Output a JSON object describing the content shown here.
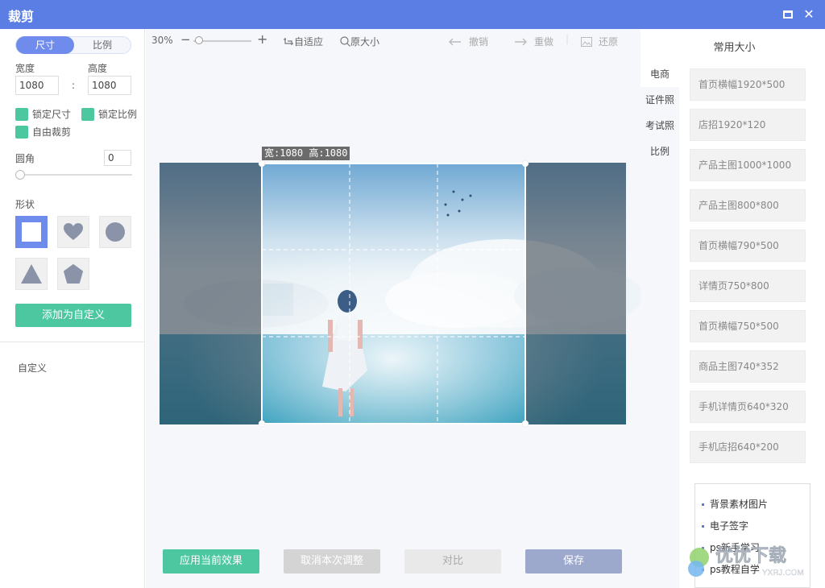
{
  "window": {
    "title": "裁剪",
    "maximize_icon": "maximize-icon",
    "close_icon": "close-icon",
    "close_glyph": "✕"
  },
  "left": {
    "mode_tabs": [
      "尺寸",
      "比例"
    ],
    "width_label": "宽度",
    "height_label": "高度",
    "width_value": "1080",
    "height_value": "1080",
    "colon": ":",
    "lock_size": "锁定尺寸",
    "lock_ratio": "锁定比例",
    "free_crop": "自由裁剪",
    "corner_label": "圆角",
    "corner_value": "0",
    "shape_label": "形状",
    "shapes": [
      "square",
      "heart",
      "circle",
      "triangle",
      "pentagon"
    ],
    "add_custom": "添加为自定义",
    "custom_label": "自定义"
  },
  "toolbar": {
    "zoom": "30%",
    "minus": "−",
    "plus": "+",
    "fit": "自适应",
    "original": "原大小",
    "undo": "撤销",
    "redo": "重做",
    "restore": "还原"
  },
  "canvas": {
    "dims_text": "宽:1080 高:1080"
  },
  "bottom": {
    "apply": "应用当前效果",
    "cancel": "取消本次调整",
    "compare": "对比",
    "save": "保存"
  },
  "right": {
    "title": "常用大小",
    "categories": [
      "电商",
      "证件照",
      "考试照",
      "比例"
    ],
    "selected_category": "电商",
    "sizes": [
      "首页横幅1920*500",
      "店招1920*120",
      "产品主图1000*1000",
      "产品主图800*800",
      "首页横幅790*500",
      "详情页750*800",
      "首页横幅750*500",
      "商品主图740*352",
      "手机详情页640*320",
      "手机店招640*200"
    ],
    "popup": [
      "背景素材图片",
      "电子签字",
      "ps新手学习",
      "ps教程自学"
    ]
  },
  "watermark": {
    "text": "优优下载",
    "sub": "YXRJ.COM"
  },
  "colors": {
    "titlebar": "#5b7ee5",
    "accent_green": "#4cc7a0",
    "accent_blue": "#6f8cec"
  }
}
